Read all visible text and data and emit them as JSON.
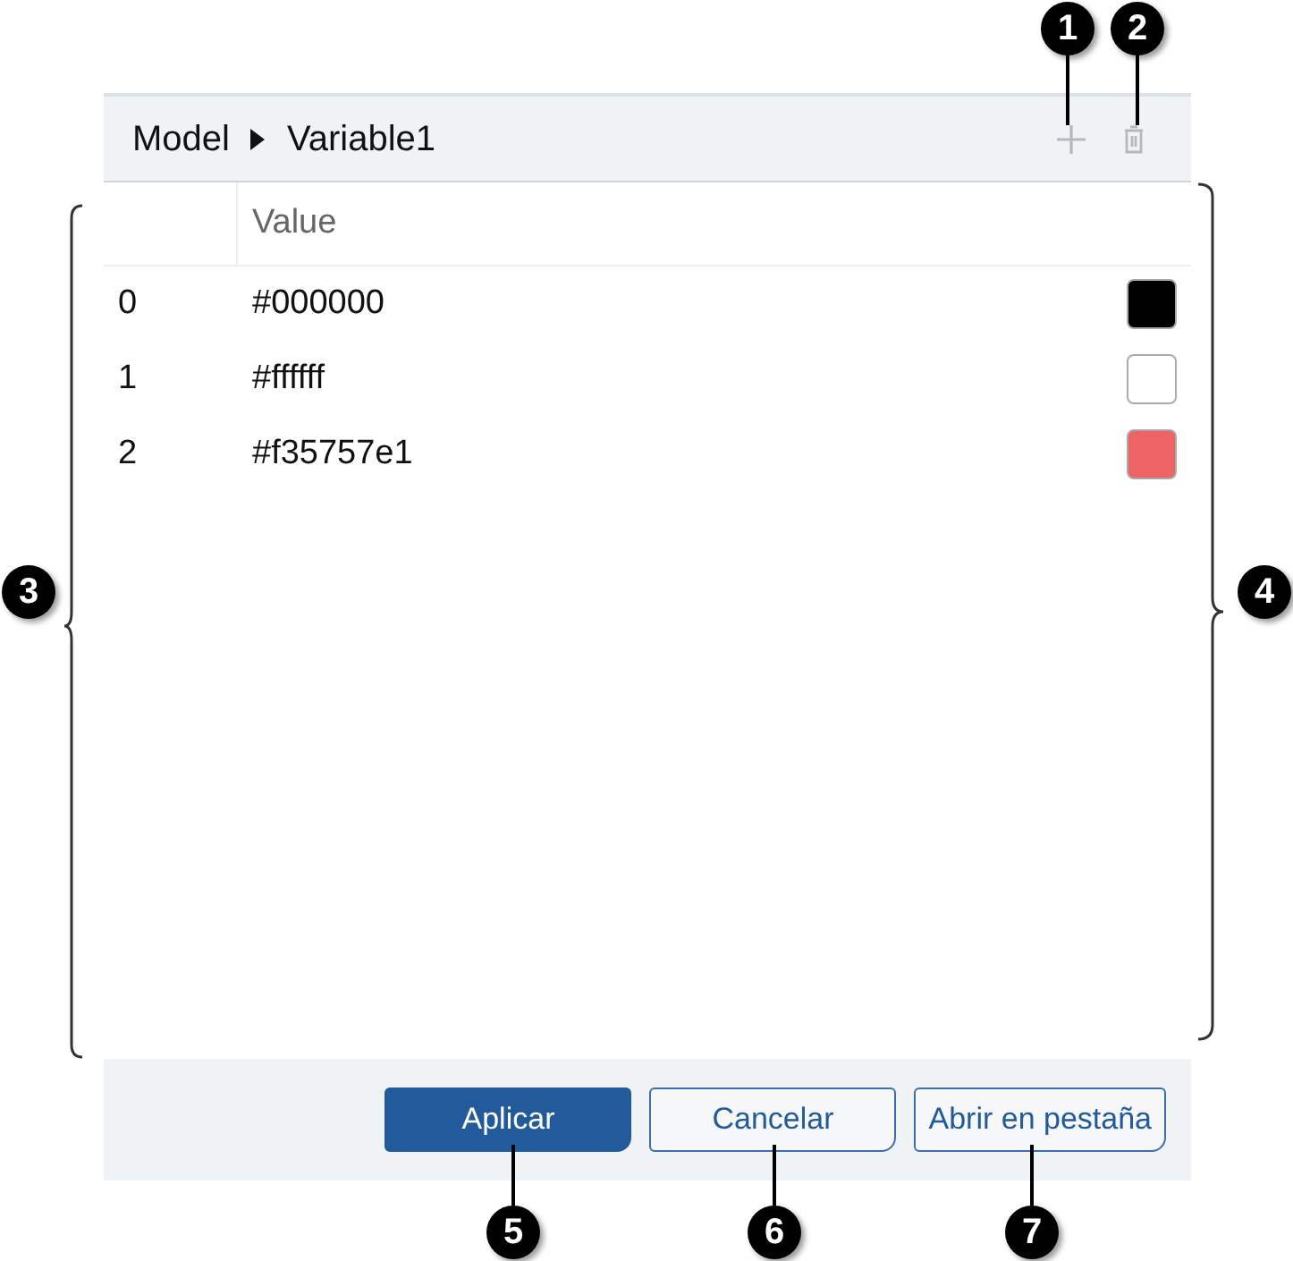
{
  "breadcrumb": {
    "parent": "Model",
    "current": "Variable1"
  },
  "table": {
    "columns": [
      "Value"
    ],
    "rows": [
      {
        "index": "0",
        "value": "#000000",
        "color": "#000000"
      },
      {
        "index": "1",
        "value": "#ffffff",
        "color": "#ffffff"
      },
      {
        "index": "2",
        "value": "#f35757e1",
        "color": "#ee6464"
      }
    ]
  },
  "buttons": [
    {
      "label": "Aplicar",
      "kind": "primary"
    },
    {
      "label": "Cancelar",
      "kind": "secondary"
    },
    {
      "label": "Abrir en pestaña",
      "kind": "secondary"
    }
  ],
  "callouts": [
    "1",
    "2",
    "3",
    "4",
    "5",
    "6",
    "7"
  ]
}
